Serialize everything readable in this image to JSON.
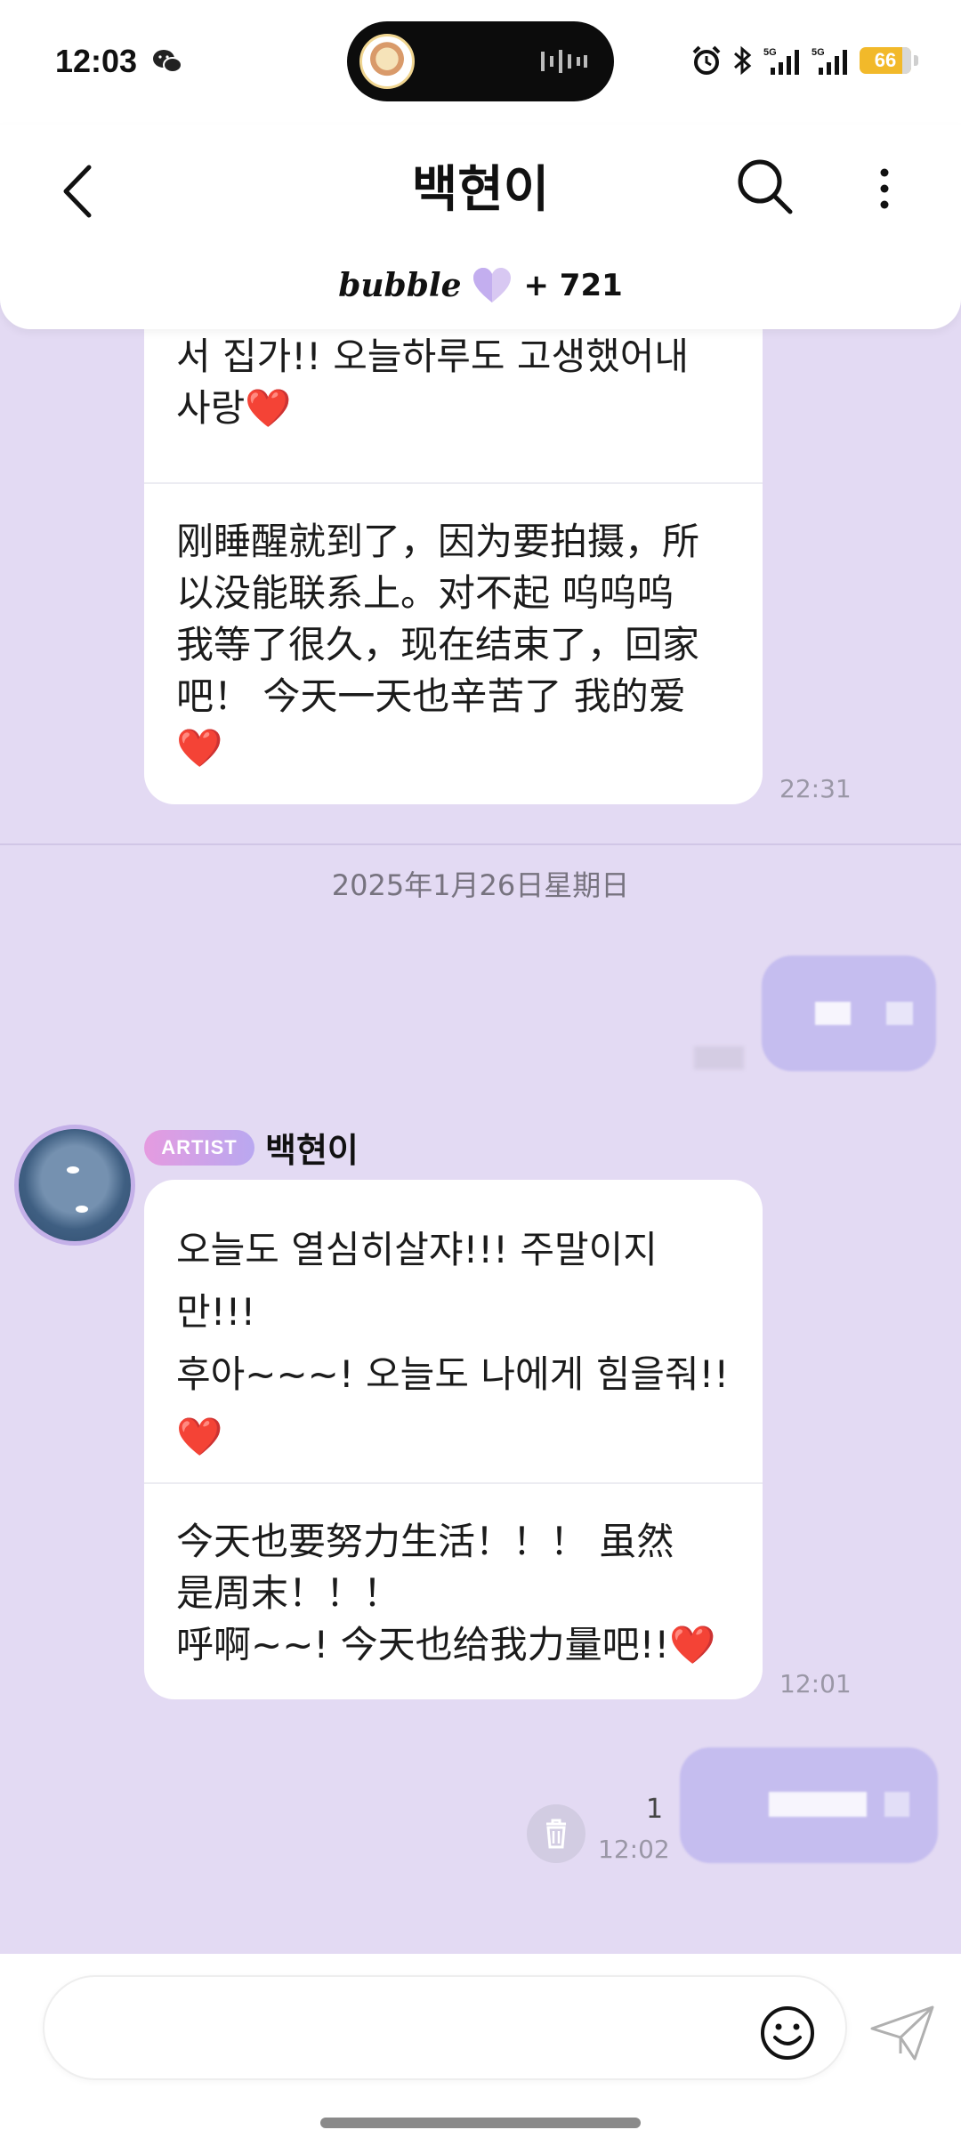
{
  "status_bar": {
    "time": "12:03",
    "battery": "66",
    "icons": [
      "wechat-icon",
      "alarm-icon",
      "bluetooth-icon",
      "5g-signal-icon",
      "5g-signal-icon"
    ]
  },
  "header": {
    "title": "백현이",
    "bubble_logo": "bubble",
    "bubble_count": "+ 721",
    "icons": [
      "back-arrow-icon",
      "search-icon",
      "more-vertical-icon"
    ]
  },
  "messages": {
    "first": {
      "korean": "서 집가!! 오늘하루도 고생했어내\n사랑",
      "heart": "❤️",
      "chinese": "刚睡醒就到了，因为要拍摄，所\n以没能联系上。对不起 呜呜呜\n我等了很久，现在结束了，回家\n吧！ 今天一天也辛苦了 我的爱",
      "time": "22:31"
    },
    "date_separator": "2025年1月26日星期日",
    "artist": {
      "badge": "ARTIST",
      "name": "백현이",
      "korean": "오늘도 열심히살쟈!!! 주말이지\n만!!!\n후아~~~! 오늘도 나에게 힘을줘!!",
      "heart": "❤️",
      "chinese": "今天也要努力生活！！！ 虽然\n是周末！！！\n呼啊~~! 今天也给我力量吧!!",
      "time": "12:01"
    },
    "sent": {
      "read_count": "1",
      "time": "12:02"
    }
  },
  "composer": {
    "placeholder": ""
  },
  "colors": {
    "chat_background": "#e3daf3",
    "sent_bubble": "#c5bdef",
    "heart": "#e0262d",
    "battery": "#f2b92a"
  }
}
